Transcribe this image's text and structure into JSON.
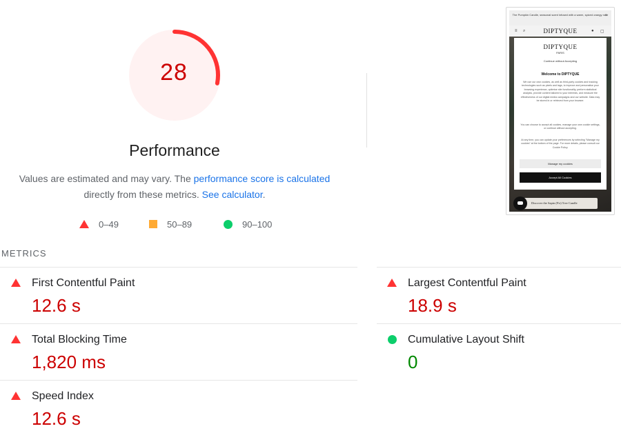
{
  "performance": {
    "score": "28",
    "score_fraction": 0.28,
    "title": "Performance",
    "description_prefix": "Values are estimated and may vary. The ",
    "link_score_calc": "performance score is calculated",
    "description_middle": "directly from these metrics.",
    "link_calculator": "See calculator",
    "description_suffix": ".",
    "colors": {
      "fail": "#ff3333",
      "average": "#ffaa33",
      "pass": "#0cce6b",
      "link": "#1a73e8"
    }
  },
  "legend": [
    {
      "icon": "triangle-icon",
      "label": "0–49"
    },
    {
      "icon": "square-icon",
      "label": "50–89"
    },
    {
      "icon": "circle-icon",
      "label": "90–100"
    }
  ],
  "screenshot": {
    "banner": "The Pumpkin Candle, seasonal scent infused with a warm, spiced orangy note",
    "brand": "DIPTYQUE",
    "brand_sub": "PARIS",
    "continue": "Continue without Accepting",
    "welcome": "Welcome to DIPTYQUE",
    "paragraph1": "We use our own cookies, as well as third-party cookies and tracking technologies such as pixels and tags, to improve and personalise your browsing experience, optimise site functionality, perform statistical analysis, provide content tailored to your interests, and measure the effectiveness of our digital media campaigns and our website. Data may be stored in or retrieved from your browser.",
    "paragraph2": "You can choose to accept all cookies, manage your own cookie settings, or continue without accepting.",
    "paragraph3": "At any time, you can update your preferences by selecting \"Manage my cookies\" at the bottom of the page. For more details, please consult our Cookie Policy.",
    "manage_button": "Manage my cookies",
    "accept_button": "Accept All Cookies",
    "promo_chip": "Discover the Sapin (Fir) Tree Candle"
  },
  "metrics": {
    "heading": "METRICS",
    "items": [
      {
        "name": "First Contentful Paint",
        "value": "12.6 s",
        "rating": "fail",
        "icon": "triangle-icon"
      },
      {
        "name": "Largest Contentful Paint",
        "value": "18.9 s",
        "rating": "fail",
        "icon": "triangle-icon"
      },
      {
        "name": "Total Blocking Time",
        "value": "1,820 ms",
        "rating": "fail",
        "icon": "triangle-icon"
      },
      {
        "name": "Cumulative Layout Shift",
        "value": "0",
        "rating": "pass",
        "icon": "circle-icon"
      },
      {
        "name": "Speed Index",
        "value": "12.6 s",
        "rating": "fail",
        "icon": "triangle-icon"
      }
    ]
  }
}
